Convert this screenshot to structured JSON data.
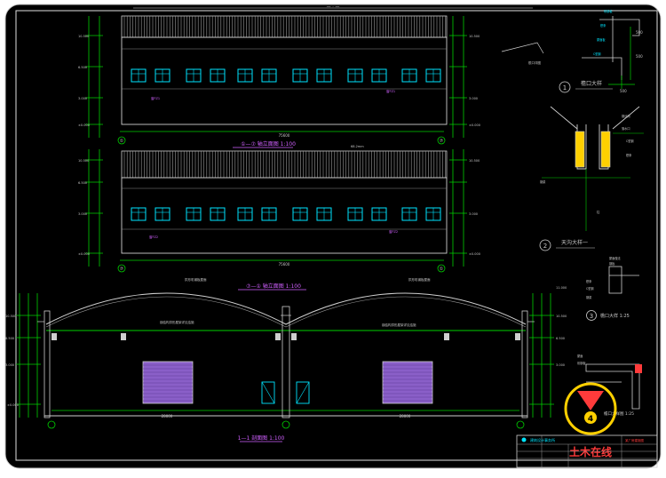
{
  "drawing": {
    "elevation_a": {
      "title": "①—⑦ 轴立面图 1:100",
      "top_dim": "68.2mm",
      "total_dim": "75600",
      "axis_left": "①",
      "axis_right": "⑦",
      "window_tag": "窗FZ1"
    },
    "elevation_b": {
      "title": "⑦—① 轴立面图 1:100",
      "top_dim": "68.2mm",
      "total_dim": "75600",
      "axis_left": "⑦",
      "axis_right": "①",
      "window_tag": "窗FZ2"
    },
    "section": {
      "title": "1—1 剖面图 1:100",
      "roof_note_left": "拱形彩钢板屋面",
      "roof_note_right": "拱形彩钢板屋面",
      "beam_note_left": "钢结构拱形屋架详见结施",
      "beam_note_right": "钢结构拱形屋架详见结施",
      "span_left": "28000",
      "span_right": "28000"
    },
    "details": {
      "detail_1": {
        "no": "1",
        "label": "檐口大样"
      },
      "detail_2": {
        "no": "2",
        "label": "天沟大样一"
      },
      "detail_3": {
        "no": "3",
        "label": "檐口大样 1:25"
      },
      "detail_4": {
        "no": "4",
        "label": "檐口大样图 1:25"
      },
      "dims": [
        "500",
        "500",
        "500"
      ]
    },
    "title_block": {
      "company": "建筑设计事务所",
      "project": "某厂房建施图",
      "watermark": "土木在线"
    },
    "colors": {
      "background": "#ffffff",
      "frame": "#000000",
      "line_grey": "#c8c8c8",
      "dim_green": "#00d000",
      "window_cyan": "#00e5ff",
      "text_white": "#ffffff",
      "magenta": "#d060ff",
      "door_purple": "#8a5fc8",
      "text_red": "#ff3b3b",
      "yellow": "#ffd000"
    }
  }
}
